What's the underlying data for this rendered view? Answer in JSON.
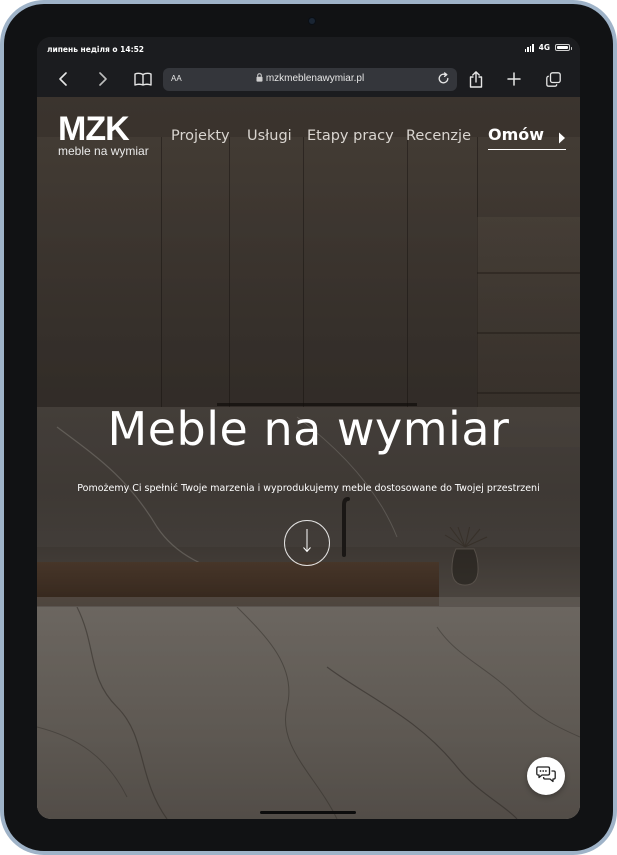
{
  "status_bar": {
    "time": "липень неділя о 14:52",
    "network": "4G"
  },
  "browser": {
    "text_size_button": "AA",
    "url": "mzkmeblenawymiar.pl"
  },
  "site": {
    "logo": {
      "mark": "MZK",
      "tagline": "meble na wymiar"
    },
    "nav": {
      "items": [
        "Projekty",
        "Usługi",
        "Etapy pracy",
        "Recenzje"
      ],
      "cta": "Omów"
    },
    "hero": {
      "title": "Meble na wymiar",
      "subtitle": "Pomożemy Ci spełnić Twoje marzenia i wyprodukujemy meble dostosowane do Twojej przestrzeni"
    }
  }
}
